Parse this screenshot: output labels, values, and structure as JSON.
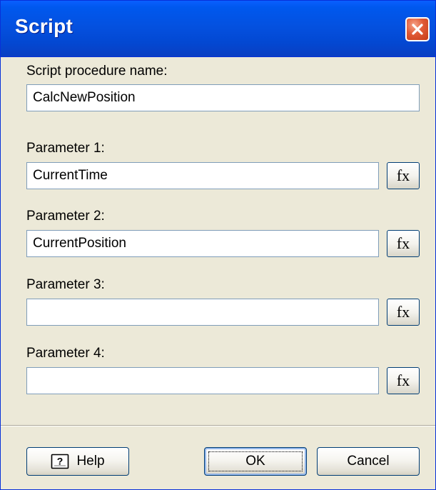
{
  "window": {
    "title": "Script"
  },
  "form": {
    "procedure_label": "Script procedure name:",
    "procedure_value": "CalcNewPosition",
    "parameters": [
      {
        "label": "Parameter 1:",
        "value": "CurrentTime",
        "fx_label": "fx"
      },
      {
        "label": "Parameter 2:",
        "value": "CurrentPosition",
        "fx_label": "fx"
      },
      {
        "label": "Parameter 3:",
        "value": "",
        "fx_label": "fx"
      },
      {
        "label": "Parameter 4:",
        "value": "",
        "fx_label": "fx"
      }
    ]
  },
  "buttons": {
    "help_label": "Help",
    "ok_label": "OK",
    "cancel_label": "Cancel"
  },
  "icons": {
    "close": "close-icon",
    "help": "help-book-icon"
  },
  "colors": {
    "title_bar": "#0058ee",
    "close_button": "#e05a35",
    "dialog_background": "#ece9d8",
    "field_border": "#7f9db9"
  }
}
